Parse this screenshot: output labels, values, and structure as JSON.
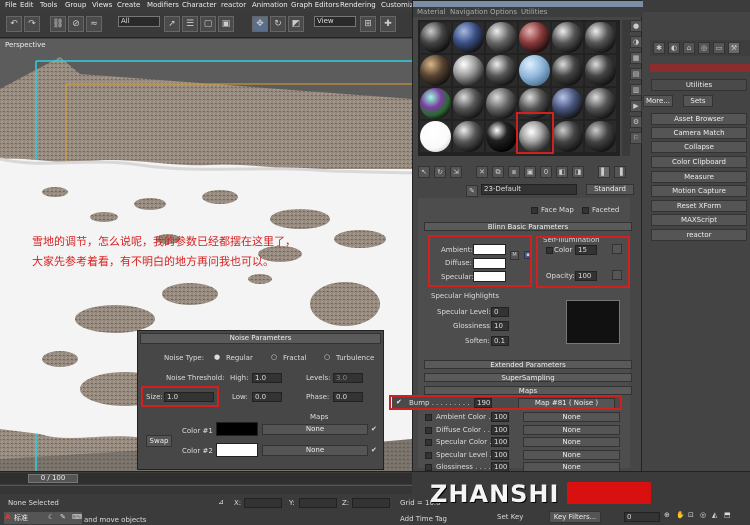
{
  "menubar": [
    "File",
    "Edit",
    "Tools",
    "Group",
    "Views",
    "Create",
    "Modifiers",
    "Character",
    "reactor",
    "Animation",
    "Graph Editors",
    "Rendering",
    "Customize"
  ],
  "toolbar": {
    "filter_value": "All",
    "view_value": "View"
  },
  "viewport": {
    "label": "Perspective"
  },
  "annotation": {
    "line1": "雪地的调节，怎么说呢，我的参数已经都摆在这里了，",
    "line2": "大家先参考着看，有不明白的地方再问我也可以。"
  },
  "material_editor": {
    "menu": [
      "Material",
      "Navigation",
      "Options",
      "Utilities"
    ],
    "material_name": "23-Default",
    "material_type": "Standard",
    "face_map": "Face Map",
    "faceted": "Faceted",
    "blinn_title": "Blinn Basic Parameters",
    "ambient": "Ambient:",
    "diffuse": "Diffuse:",
    "specular": "Specular:",
    "self_illum": "Self-Illumination",
    "color_label": "Color",
    "color_value": "15",
    "opacity_label": "Opacity:",
    "opacity_value": "100",
    "spec_highlights": "Specular Highlights",
    "spec_level_label": "Specular Level:",
    "spec_level": "0",
    "glossiness_label": "Glossiness:",
    "glossiness": "10",
    "soften_label": "Soften:",
    "soften": "0.1",
    "extended": "Extended Parameters",
    "supersampling": "SuperSampling",
    "maps": "Maps",
    "bump_label": "Bump . . . . . . . . .",
    "bump_amount": "190",
    "bump_map": "Map #81  ( Noise )",
    "map_rows": [
      {
        "name": "Ambient Color . . .",
        "amount": "100",
        "map": "None"
      },
      {
        "name": "Diffuse Color . . .",
        "amount": "100",
        "map": "None"
      },
      {
        "name": "Specular Color . .",
        "amount": "100",
        "map": "None"
      },
      {
        "name": "Specular Level . .",
        "amount": "100",
        "map": "None"
      },
      {
        "name": "Glossiness . . . .",
        "amount": "100",
        "map": "None"
      }
    ]
  },
  "noise": {
    "title": "Noise Parameters",
    "type_label": "Noise Type:",
    "regular": "Regular",
    "fractal": "Fractal",
    "turbulence": "Turbulence",
    "threshold_label": "Noise Threshold:",
    "high_label": "High:",
    "high": "1.0",
    "levels_label": "Levels:",
    "levels": "3.0",
    "size_label": "Size:",
    "size": "1.0",
    "low_label": "Low:",
    "low": "0.0",
    "phase_label": "Phase:",
    "phase": "0.0",
    "maps_label": "Maps",
    "swap": "Swap",
    "color1": "Color #1",
    "color2": "Color #2",
    "none1": "None",
    "none2": "None"
  },
  "utilities": {
    "more": "More...",
    "sets": "Sets",
    "header": "Utilities",
    "items": [
      "Asset Browser",
      "Camera Match",
      "Collapse",
      "Color Clipboard",
      "Measure",
      "Motion Capture",
      "Reset XForm",
      "MAXScript",
      "reactor"
    ]
  },
  "status": {
    "frame": "0 / 100",
    "none_selected": "None Selected",
    "std": "标准",
    "hint": "and move objects",
    "x_label": "X:",
    "y_label": "Y:",
    "z_label": "Z:",
    "grid": "Grid = 10.0",
    "add_time_tag": "Add Time Tag",
    "set_key": "Set Key",
    "key_filters": "Key Filters...",
    "frame_field": "0"
  },
  "watermark": "ZHANSHI"
}
